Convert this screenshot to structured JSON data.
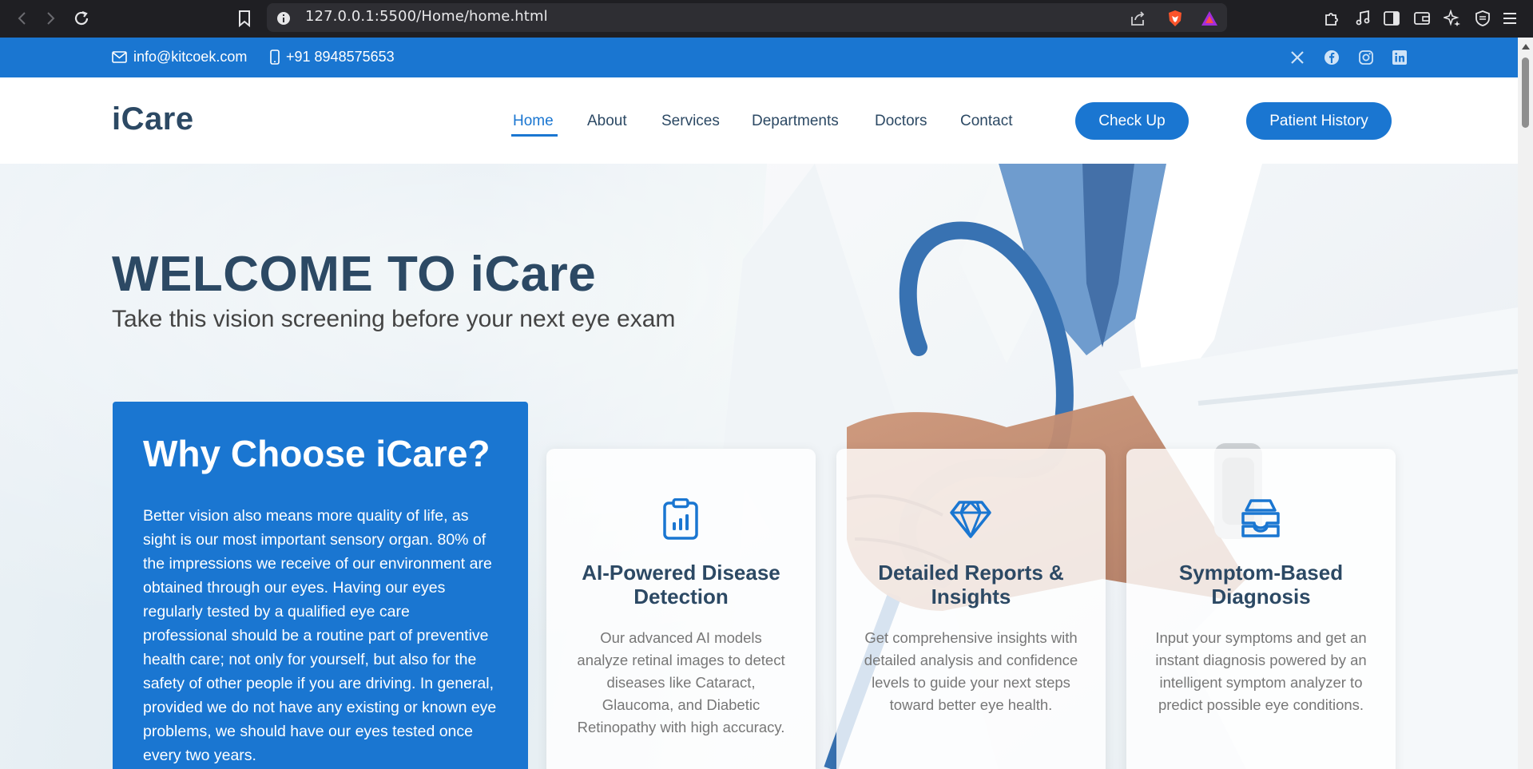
{
  "browser": {
    "url": "127.0.0.1:5500/Home/home.html",
    "icons": [
      "back-icon",
      "forward-icon",
      "reload-icon",
      "bookmark-icon",
      "site-info-icon",
      "share-icon",
      "brave-shields-icon",
      "brave-rewards-icon",
      "extensions-icon",
      "media-icon",
      "sidebar-icon",
      "wallet-icon",
      "leo-ai-icon",
      "vpn-icon",
      "menu-icon"
    ]
  },
  "topbar": {
    "email": "info@kitcoek.com",
    "phone": "+91 8948575653",
    "social_icons": [
      "x-twitter-icon",
      "facebook-icon",
      "instagram-icon",
      "linkedin-icon"
    ]
  },
  "header": {
    "logo": "iCare",
    "nav": [
      "Home",
      "About",
      "Services",
      "Departments",
      "Doctors",
      "Contact"
    ],
    "active_nav": "Home",
    "checkup_button": "Check Up",
    "history_button": "Patient History"
  },
  "hero": {
    "title": "WELCOME TO iCare",
    "subtitle": "Take this vision screening before your next eye exam"
  },
  "why": {
    "title": "Why Choose iCare?",
    "text": "Better vision also means more quality of life, as sight is our most important sensory organ. 80% of the impressions we receive of our environment are obtained through our eyes. Having our eyes regularly tested by a qualified eye care professional should be a routine part of preventive health care; not only for yourself, but also for the safety of other people if you are driving. In general, provided we do not have any existing or known eye problems, we should have our eyes tested once every two years."
  },
  "features": [
    {
      "icon": "clipboard-chart-icon",
      "title": "AI-Powered Disease Detection",
      "text": "Our advanced AI models analyze retinal images to detect diseases like Cataract, Glaucoma, and Diabetic Retinopathy with high accuracy."
    },
    {
      "icon": "gem-icon",
      "title": "Detailed Reports & Insights",
      "text": "Get comprehensive insights with detailed analysis and confidence levels to guide your next steps toward better eye health."
    },
    {
      "icon": "inbox-icon",
      "title": "Symptom-Based Diagnosis",
      "text": "Input your symptoms and get an instant diagnosis powered by an intelligent symptom analyzer to predict possible eye conditions."
    }
  ],
  "colors": {
    "primary": "#1a76d1",
    "heading": "#2c4964",
    "body_text": "#777777"
  }
}
